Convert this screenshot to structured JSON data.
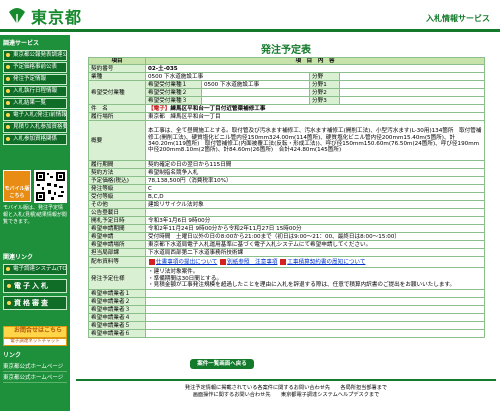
{
  "header": {
    "logo_text": "東京都",
    "service_title": "入札情報サービス"
  },
  "sidebar": {
    "section_top": "調達サービス",
    "nav": [
      "東京都公報発表調達公告",
      "予定価格事前公表",
      "発注予定情報",
      "入札執行日程情報",
      "入札結果一覧",
      "電子入札(発注)前情報",
      "見積り入札参加資格要件",
      "入札参加資格関係"
    ],
    "mobile_label": "モバイル版",
    "mobile_sub": "こちら",
    "mobile_text": "モバイル版は、発注予定情報と入札(見積)結果情報が閲覧できます。",
    "section_related": "関連リンク",
    "related_nav": [
      "電子調達システム(TOP)"
    ],
    "big_nav": [
      "電子入札",
      "資格審査"
    ],
    "sodan_label": "お問合せはこちら",
    "sodan_sub": "電子調達ネットチャット",
    "section_link": "リンク",
    "links": [
      "東京都公式ホームページ",
      "東京都公式ホームページ"
    ]
  },
  "main": {
    "title": "発注予定表",
    "table_header": {
      "item": "項目",
      "content": "項　目　内　容"
    },
    "rows": {
      "keiyaku_no_label": "契約番号",
      "keiyaku_no": "02-土-035",
      "gyoshu_label": "業種",
      "gyoshu": "0500 下水道施設工事",
      "bunya_label": "分野",
      "bunya1_label": "分野1",
      "bunya2_label": "分野2",
      "bunya3_label": "分野3",
      "kibo_label": "希望受付業種",
      "kibo1_label": "希望受付業種１",
      "kibo1": "0500 下水道施設工事",
      "kibo2_label": "希望受付業種２",
      "kibo3_label": "希望受付業種３",
      "kenmei_label": "件　名",
      "kenmei_tag": "【電子】",
      "kenmei": "練馬区平和台一丁目付近管渠補修工事",
      "basho_label": "履行場所",
      "basho": "東京都　練馬区平和台一丁目",
      "gaiyo_label": "概要",
      "gaiyo": "本工事は、全て昼間施工とする。取付管及び汚水ます補修工、汚水ます補修工(開削工法)、小型汚水ます(L-30用)134箇所　取付管補修工(開削工法)、硬質塩化ビニル管内径150mm324.00m(114箇所)、硬質塩化ビニル管内径200mm15.40m(5箇所)、計340.20m(119箇所)　取付管補修工(内面被覆工法(反転・形成工法))、呼び径150mm150.60m(76.50m(24箇所)、呼び径190mm中径200mm8.10m(2箇所)、計84.60m(26箇所)　合計424.80m(145箇所)",
      "kigen_label": "履行期間",
      "kigen": "契約確定の日の翌日から115日間",
      "hoho_label": "契約方法",
      "hoho": "希望制指名競争入札",
      "yotei_label": "予定価格(税込)",
      "yotei": "78,138,500円（消費税率10%）",
      "hacchu_label": "発注等級",
      "hacchu": "C",
      "juchu_label": "受付等級",
      "juchu": "B,C,D",
      "sonota_label": "その他",
      "sonota": "建設リサイクル法対象",
      "kokoku_label": "公告登載日",
      "kokoku": "",
      "kaihi_label": "開札予定日時",
      "kaihi": "令和3年1月6日 9時00分",
      "kibokikan_label": "希望申請期間",
      "kibokikan": "令和2年11月24日 9時00分から令和2年11月27日 15時00分",
      "kiboho_label": "希望申請",
      "kiboho": "受付時間　土曜日以外の日の8:00から21:00まで（初日は9:00〜21：00、最終日は8:00〜15:00）",
      "uketsuke_label": "希望申請場所",
      "uketsuke": "東京都下水道局電子入札運用基準に基づく電子入札システムにて希望申請してください。",
      "tanto_label": "担当局部課",
      "tanto": "下水道局西部第二下水道事務所技術課",
      "haifu_label": "配布資料等",
      "haifu1": "仕書事項の提出について",
      "haifu2": "別紙参照　注意事項",
      "haifu3": "工事積算契約書の周知について",
      "youryo_label": "発注予定仕様",
      "youryo1": "・建リ法対象案件。",
      "youryo2": "・準備期間は30日間とする。",
      "youryo3": "・見積金額が工事発注規模を超過したことを理由に入札を辞退する際は、任意で積算内訳書のご提出をお願いいたします。",
      "req_labels": [
        "希望申請業者１",
        "希望申請業者２",
        "希望申請業者３",
        "希望申請業者４",
        "希望申請業者５",
        "希望申請業者６"
      ]
    },
    "back_button": "案件一覧画面へ戻る"
  },
  "footer": {
    "line1": "発注予定情報に掲載されている各案件に関するお問い合わせ先　　各局所担当部署まで",
    "line2": "画面操作に関するお問い合わせ先　　東京都電子調達システムヘルプデスクまで"
  },
  "colors": {
    "brand_green": "#127a2a",
    "side_green": "#1e8f3a",
    "label_bg": "#d9f0d2",
    "header_bg": "#c7e3a9",
    "alert_red": "#c01010"
  }
}
